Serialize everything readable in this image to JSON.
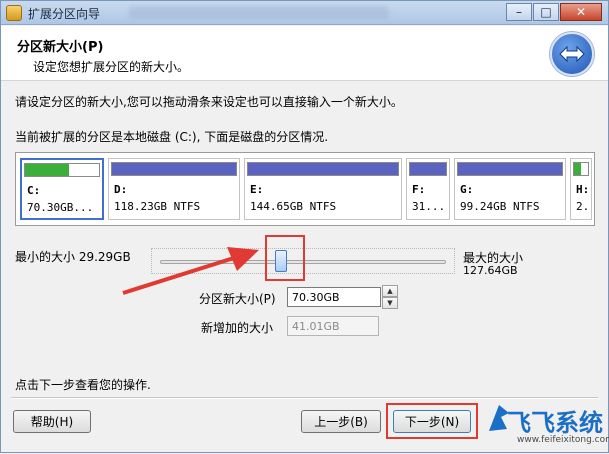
{
  "window": {
    "title": "扩展分区向导",
    "min_icon": "minimize-icon",
    "max_icon": "maximize-icon",
    "close_icon": "close-icon"
  },
  "header": {
    "title": "分区新大小(P)",
    "subtitle": "设定您想扩展分区的新大小。",
    "logo_icon": "wizard-arrows-icon"
  },
  "body": {
    "instruction": "请设定分区的新大小,您可以拖动滑条来设定也可以直接输入一个新大小。",
    "current_partition_text": "当前被扩展的分区是本地磁盘 (C:), 下面是磁盘的分区情况."
  },
  "partitions": [
    {
      "letter": "C:",
      "info": "70.30GB...",
      "fill": 0.6,
      "color": "#3cae3c"
    },
    {
      "letter": "D:",
      "info": "118.23GB NTFS",
      "fill": 1.0,
      "color": "#5a64c0"
    },
    {
      "letter": "E:",
      "info": "144.65GB NTFS",
      "fill": 1.0,
      "color": "#5a64c0"
    },
    {
      "letter": "F:",
      "info": "31...",
      "fill": 1.0,
      "color": "#5a64c0"
    },
    {
      "letter": "G:",
      "info": "99.24GB NTFS",
      "fill": 1.0,
      "color": "#5a64c0"
    },
    {
      "letter": "H:",
      "info": "2.",
      "fill": 0.5,
      "color": "#3cae3c"
    }
  ],
  "slider": {
    "min_label": "最小的大小 29.29GB",
    "max_label": "最大的大小",
    "max_value": "127.64GB",
    "value_fraction": 0.42
  },
  "fields": {
    "new_size_label": "分区新大小(P)",
    "new_size_value": "70.30GB",
    "added_size_label": "新增加的大小",
    "added_size_value": "41.01GB"
  },
  "footer": {
    "hint": "点击下一步查看您的操作.",
    "help_label": "帮助(H)",
    "back_label": "上一步(B)",
    "next_label": "下一步(N)"
  },
  "watermark": {
    "text": "飞飞系统",
    "url": "www.feifeixitong.com"
  },
  "colors": {
    "annotation_red": "#e03a32",
    "watermark_blue": "#1c6fc7"
  }
}
